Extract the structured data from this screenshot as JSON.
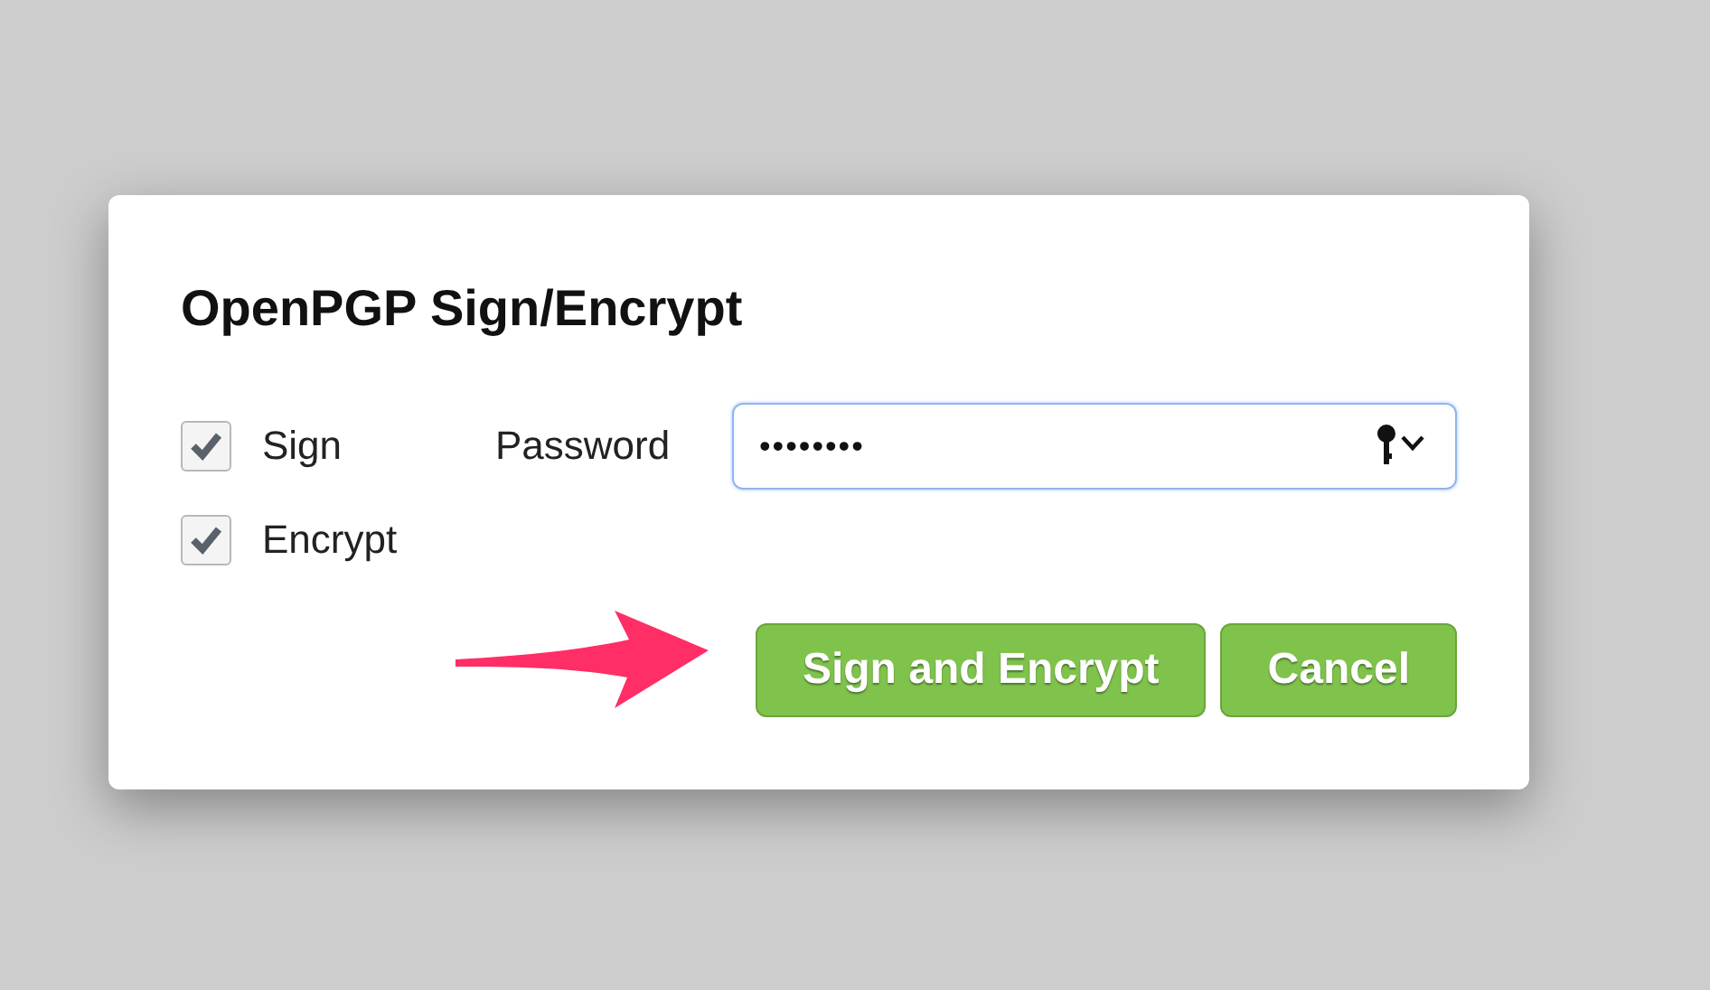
{
  "dialog": {
    "title": "OpenPGP Sign/Encrypt",
    "options": [
      {
        "label": "Sign",
        "checked": true
      },
      {
        "label": "Encrypt",
        "checked": true
      }
    ],
    "password": {
      "label": "Password",
      "value": "••••••••"
    },
    "buttons": [
      {
        "label": "Sign and Encrypt"
      },
      {
        "label": "Cancel"
      }
    ]
  }
}
